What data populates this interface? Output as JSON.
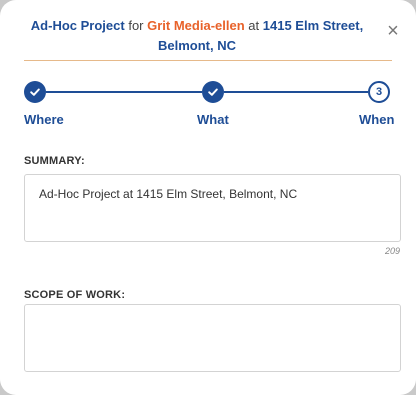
{
  "header": {
    "kind": "Ad-Hoc Project",
    "for_text": "for",
    "client": "Grit Media-ellen",
    "at_text": "at",
    "address": "1415 Elm Street, Belmont, NC",
    "close_symbol": "×"
  },
  "stepper": {
    "steps": [
      {
        "label": "Where",
        "status": "done"
      },
      {
        "label": "What",
        "status": "done"
      },
      {
        "label": "When",
        "status": "current",
        "number": "3"
      }
    ]
  },
  "summary": {
    "label": "SUMMARY:",
    "value": "Ad-Hoc Project at 1415 Elm Street, Belmont, NC",
    "char_count": "209"
  },
  "scope": {
    "label": "SCOPE OF WORK:",
    "value": ""
  },
  "colors": {
    "primary": "#1e4d96",
    "accent": "#e8622a",
    "divider": "#e6b98a"
  }
}
